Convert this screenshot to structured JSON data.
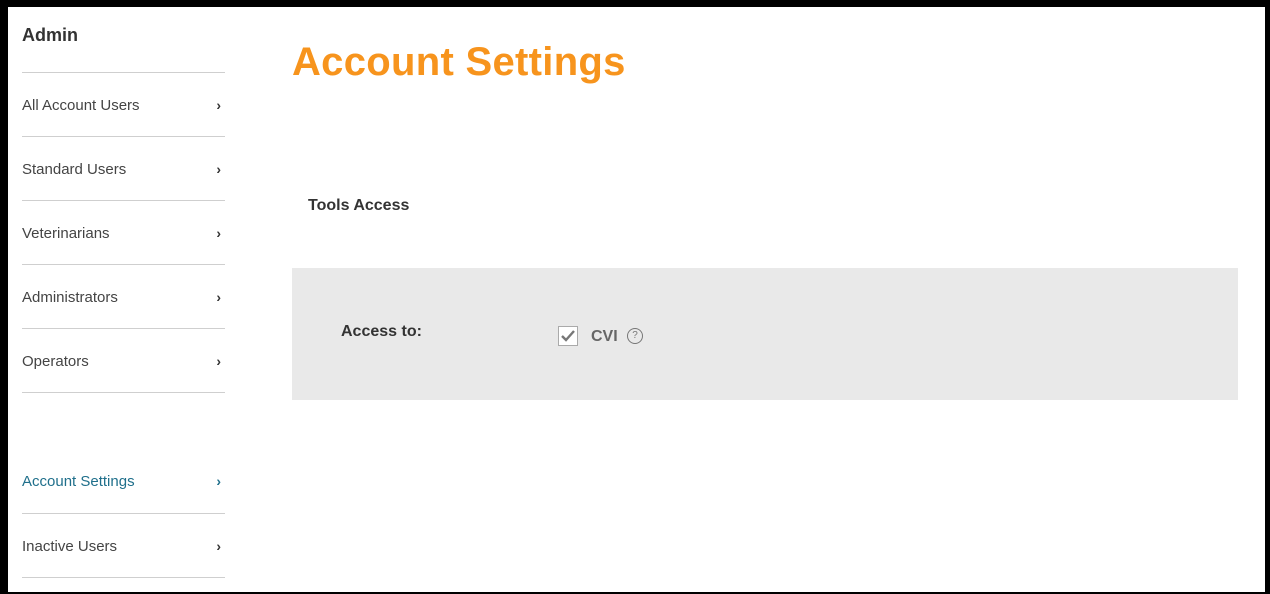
{
  "sidebar": {
    "title": "Admin",
    "items": [
      {
        "label": "All Account Users",
        "chevron": "›"
      },
      {
        "label": "Standard Users",
        "chevron": "›"
      },
      {
        "label": "Veterinarians",
        "chevron": "›"
      },
      {
        "label": "Administrators",
        "chevron": "›"
      },
      {
        "label": "Operators",
        "chevron": "›"
      }
    ],
    "secondary_items": [
      {
        "label": "Account Settings",
        "chevron": "›",
        "active": true
      },
      {
        "label": "Inactive Users",
        "chevron": "›"
      }
    ]
  },
  "main": {
    "title": "Account Settings",
    "section_heading": "Tools Access",
    "access_label": "Access to:",
    "tools": [
      {
        "label": "CVI",
        "checked": true,
        "help_icon": "?"
      }
    ]
  },
  "colors": {
    "accent": "#f7941d",
    "active_link": "#1f6f8b",
    "panel_bg": "#e9e9e9"
  }
}
